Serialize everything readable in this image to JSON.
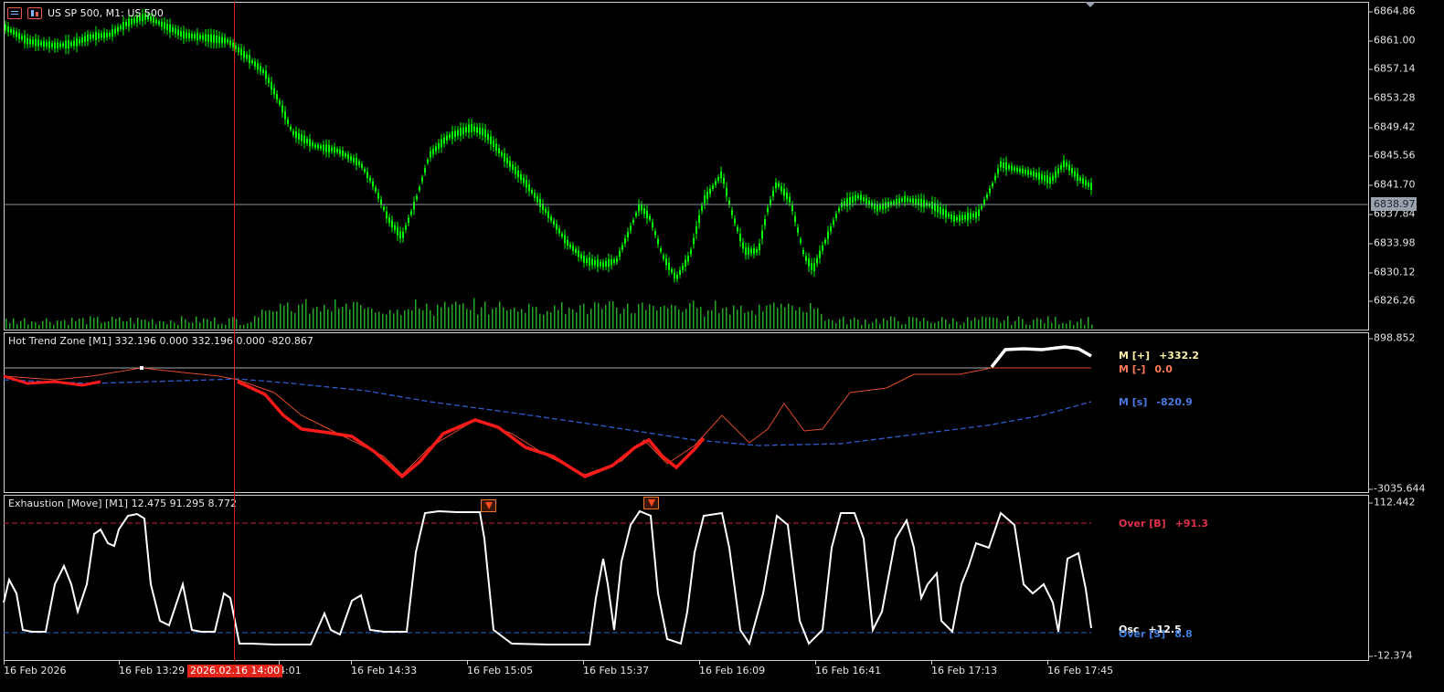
{
  "title": "US SP 500, M1:  US 500",
  "price_axis": {
    "ticks": [
      "6864.86",
      "6861.00",
      "6857.14",
      "6853.28",
      "6849.42",
      "6845.56",
      "6841.70",
      "6837.84",
      "6833.98",
      "6830.12",
      "6826.26"
    ],
    "current_price": "6838.97"
  },
  "trend_pane": {
    "label": "Hot Trend Zone [M1] 332.196 0.000 332.196 0.000 -820.867",
    "scale_max": "898.852",
    "scale_min": "-3035.644",
    "legend": [
      {
        "name": "M [+]",
        "value": "+332.2",
        "color": "#fff3a8"
      },
      {
        "name": "M [-]",
        "value": "0.0",
        "color": "#ff7a5a"
      },
      {
        "name": "M [s]",
        "value": "-820.9",
        "color": "#4a78e0"
      }
    ]
  },
  "exhaustion_pane": {
    "label": "Exhaustion [Move] [M1] 12.475 91.295 8.772",
    "scale_max": "112.442",
    "scale_min": "-12.374",
    "legend": [
      {
        "name": "Over [B]",
        "value": "+91.3",
        "color": "#e0304a"
      },
      {
        "name": "Osc",
        "value": "+12.5",
        "color": "#ffffff"
      },
      {
        "name": "Over [S]",
        "value": "8.8",
        "color": "#3a7ad8"
      }
    ]
  },
  "time_axis": {
    "ticks": [
      "16 Feb 2026",
      "16 Feb 13:29",
      "4:01",
      "16 Feb 14:33",
      "16 Feb 15:05",
      "16 Feb 15:37",
      "16 Feb 16:09",
      "16 Feb 16:41",
      "16 Feb 17:13",
      "16 Feb 17:45"
    ],
    "crosshair_label": "2026.02.16 14:00"
  },
  "colors": {
    "candle": "#00ff00",
    "volume": "#22a822",
    "crosshair": "#dd2222",
    "trend_up": "#ffffff",
    "trend_down": "#ff1a1a"
  }
}
